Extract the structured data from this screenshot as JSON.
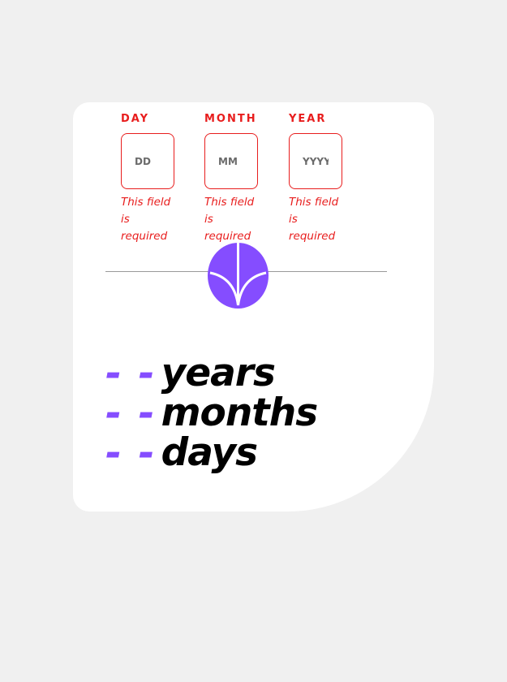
{
  "form": {
    "fields": [
      {
        "label": "DAY",
        "placeholder": "DD",
        "error": "This field is required"
      },
      {
        "label": "MONTH",
        "placeholder": "MM",
        "error": "This field is required"
      },
      {
        "label": "YEAR",
        "placeholder": "YYYY",
        "error": "This field is required"
      }
    ],
    "submit_icon": "arrow-down-icon"
  },
  "results": [
    {
      "value": "- -",
      "unit": "years"
    },
    {
      "value": "- -",
      "unit": "months"
    },
    {
      "value": "- -",
      "unit": "days"
    }
  ],
  "colors": {
    "accent": "#854dff",
    "error": "#e81d1d",
    "page_background": "#f0f0f0",
    "card_background": "#ffffff",
    "text": "#000000"
  }
}
